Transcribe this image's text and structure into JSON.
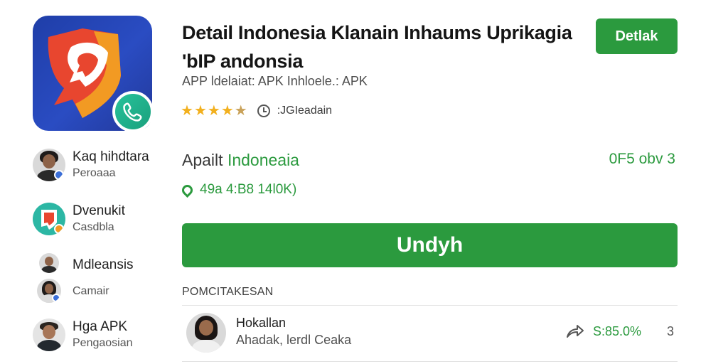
{
  "header": {
    "title_line1": "Detail Indonesia Klanain Inhaums Uprikagia",
    "title_line2": "'bIP andonsia",
    "subtitle": "APP ldelaiat: APK Inhloele.: APK",
    "detail_button": "Detlak",
    "rating_text": ":JGIeadain",
    "stars": 4.5
  },
  "sidebar": {
    "items": [
      {
        "title": "Kaq hihdtara",
        "sub": "Peroaaa"
      },
      {
        "title": "Dvenukit",
        "sub": "Casdbla"
      },
      {
        "title": "Mdleansis",
        "sub": "Camair"
      },
      {
        "title": "Hga APK",
        "sub": "Pengaosian"
      }
    ]
  },
  "main": {
    "publisher_label": "Apailt",
    "publisher_name": "Indoneaia",
    "version": "0F5 obv  3",
    "size_info": "49a 4:B8 14l0K)",
    "download_label": "Undyh",
    "section_title": "POMCITAKESAN",
    "comment": {
      "name": "Hokallan",
      "text": "Ahadak, lerdl Ceaka",
      "percent": "S:85.0%",
      "more": "3"
    }
  },
  "colors": {
    "accent_green": "#2b9a3e",
    "icon_blue": "#1f3ea8",
    "star_gold": "#f2b01e"
  },
  "icons": [
    "app-logo-icon",
    "phone-icon",
    "star-icon",
    "clock-icon",
    "pin-icon",
    "share-icon",
    "more-icon"
  ]
}
